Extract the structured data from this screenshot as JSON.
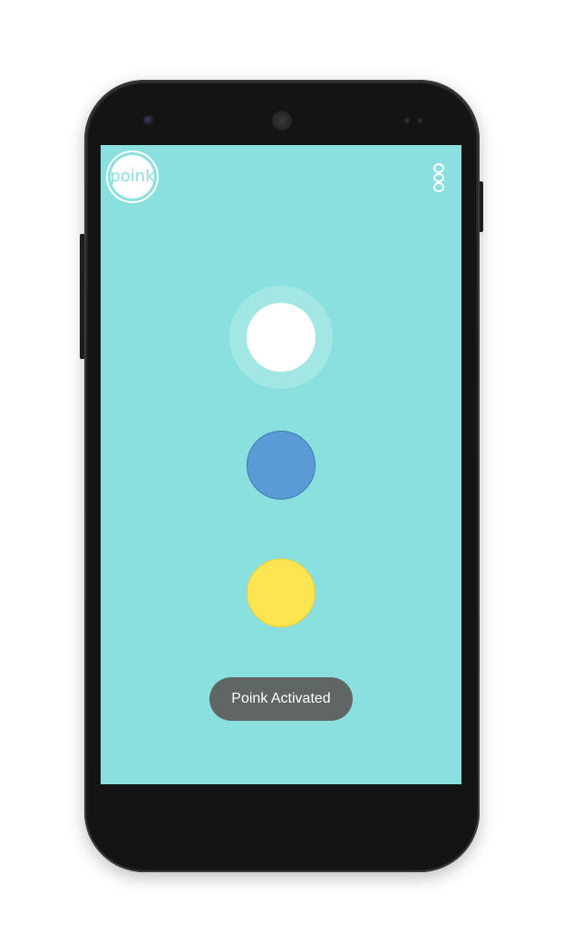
{
  "app": {
    "logo_text": "poink",
    "background_color": "#8ae0de"
  },
  "header": {
    "menu_icon": "overflow-menu-icon"
  },
  "main": {
    "buttons": [
      {
        "name": "white",
        "color": "#ffffff",
        "selected": true
      },
      {
        "name": "blue",
        "color": "#5b9bd5",
        "selected": false
      },
      {
        "name": "yellow",
        "color": "#fde451",
        "selected": false
      }
    ]
  },
  "toast": {
    "message": "Poink Activated"
  }
}
